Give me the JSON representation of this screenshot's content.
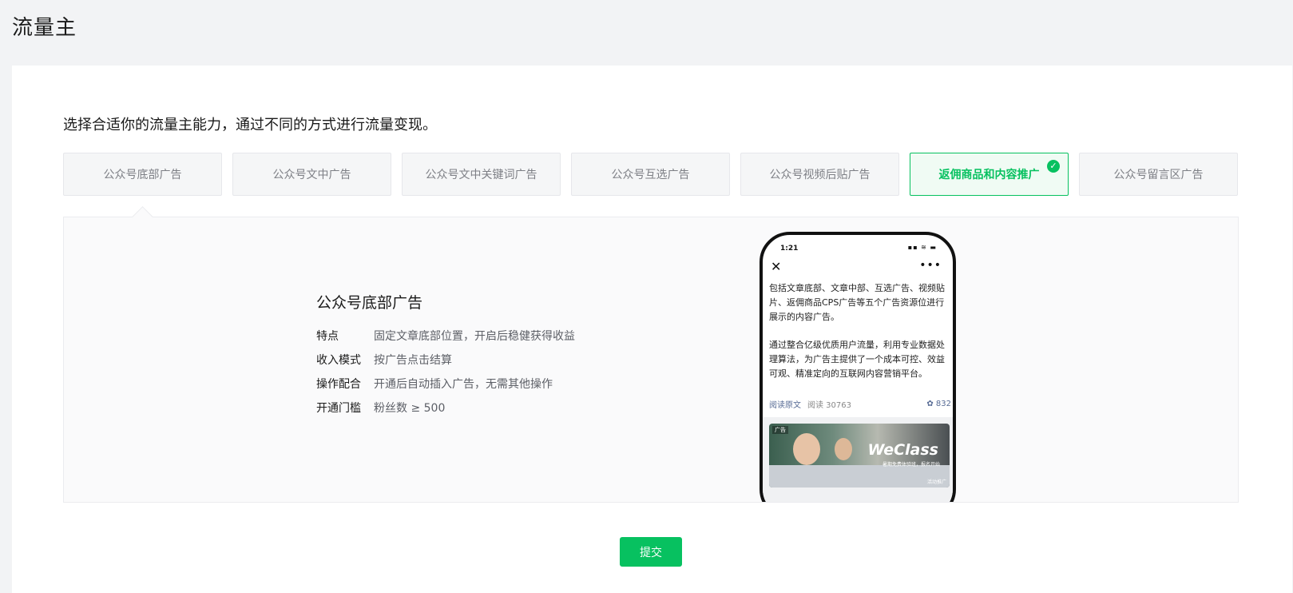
{
  "page": {
    "title": "流量主"
  },
  "intro": "选择合适你的流量主能力，通过不同的方式进行流量变现。",
  "tabs": [
    {
      "label": "公众号底部广告",
      "active": false
    },
    {
      "label": "公众号文中广告",
      "active": false
    },
    {
      "label": "公众号文中关键词广告",
      "active": false
    },
    {
      "label": "公众号互选广告",
      "active": false
    },
    {
      "label": "公众号视频后贴广告",
      "active": false
    },
    {
      "label": "返佣商品和内容推广",
      "active": true
    },
    {
      "label": "公众号留言区广告",
      "active": false
    }
  ],
  "panel": {
    "title": "公众号底部广告",
    "rows": [
      {
        "key": "特点",
        "value": "固定文章底部位置，开启后稳健获得收益"
      },
      {
        "key": "收入模式",
        "value": "按广告点击结算"
      },
      {
        "key": "操作配合",
        "value": "开通后自动插入广告，无需其他操作"
      },
      {
        "key": "开通门槛",
        "value": "粉丝数 ≥ 500"
      }
    ]
  },
  "phone": {
    "time": "1:21",
    "status_icons": "▪▪ ≋ ▬",
    "article_p1": "包括文章底部、文章中部、互选广告、视频贴片、返佣商品CPS广告等五个广告资源位进行展示的内容广告。",
    "article_p2": "通过整合亿级优质用户流量，利用专业数据处理算法，为广告主提供了一个成本可控、效益可观、精准定向的互联网内容营销平台。",
    "read_original": "阅读原文",
    "read_count": "阅读 30763",
    "like_count": "832",
    "ad": {
      "tag": "广告",
      "logo": "WeClass",
      "slogan": "暑期免费体验班，报名开始",
      "footer": "活动推广"
    }
  },
  "submit_label": "提交",
  "colors": {
    "accent": "#07c160",
    "background": "#f2f3f5"
  }
}
